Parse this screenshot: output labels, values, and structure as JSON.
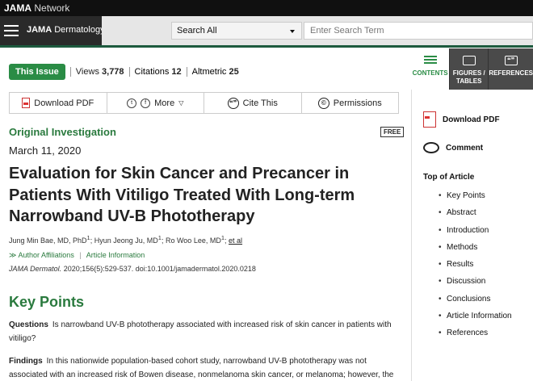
{
  "network": {
    "brand": "JAMA",
    "suffix": " Network"
  },
  "header": {
    "journal_bold": "JAMA",
    "journal_rest": " Dermatology",
    "search_select": "Search All",
    "search_placeholder": "Enter Search Term"
  },
  "meta": {
    "issue_button": "This Issue",
    "views_label": "Views",
    "views": "3,778",
    "citations_label": "Citations",
    "citations": "12",
    "altmetric_label": "Altmetric",
    "altmetric": "25"
  },
  "toolbar": {
    "download_pdf": "Download PDF",
    "twitter": "t",
    "facebook": "f",
    "more": "More",
    "more_caret": "▽",
    "cite": "Cite This",
    "cite_icon": "❝❞",
    "permissions": "Permissions",
    "permissions_icon": "©"
  },
  "article": {
    "section_type": "Original Investigation",
    "free_badge": "FREE",
    "date": "March 11, 2020",
    "title": "Evaluation for Skin Cancer and Precancer in Patients With Vitiligo Treated With Long-term Narrowband UV-B Phototherapy",
    "author1": "Jung Min Bae, MD, PhD",
    "author2": "Hyun Jeong Ju, MD",
    "author3": "Ro Woo Lee, MD",
    "sup": "1",
    "etal": "et al",
    "affiliations": "Author Affiliations",
    "aff_separator": "|",
    "article_info": "Article Information",
    "journal_abbrev": "JAMA Dermatol.",
    "citation_rest": " 2020;156(5):529-537. doi:10.1001/jamadermatol.2020.0218",
    "key_points_title": "Key Points",
    "questions_label": "Questions",
    "questions_text": "Is narrowband UV-B phototherapy associated with increased risk of skin cancer in patients with vitiligo?",
    "findings_label": "Findings",
    "findings_text": "In this nationwide population-based cohort study, narrowband UV-B phototherapy was not associated with an increased risk of Bowen disease, nonmelanoma skin cancer, or melanoma; however, the risk of ac-"
  },
  "sidebar": {
    "tabs": [
      {
        "label": "CONTENTS",
        "icon": "list-icon"
      },
      {
        "label": "FIGURES / TABLES",
        "icon": "chart-icon"
      },
      {
        "label": "REFERENCES",
        "icon": "quote-icon"
      }
    ],
    "references_glyph": "❝❞",
    "download_pdf": "Download PDF",
    "comment": "Comment",
    "toc_title": "Top of Article",
    "toc": [
      "Key Points",
      "Abstract",
      "Introduction",
      "Methods",
      "Results",
      "Discussion",
      "Conclusions",
      "Article Information",
      "References"
    ]
  },
  "colors": {
    "accent_green": "#2a8c45",
    "header_dark": "#2a2a2a"
  }
}
